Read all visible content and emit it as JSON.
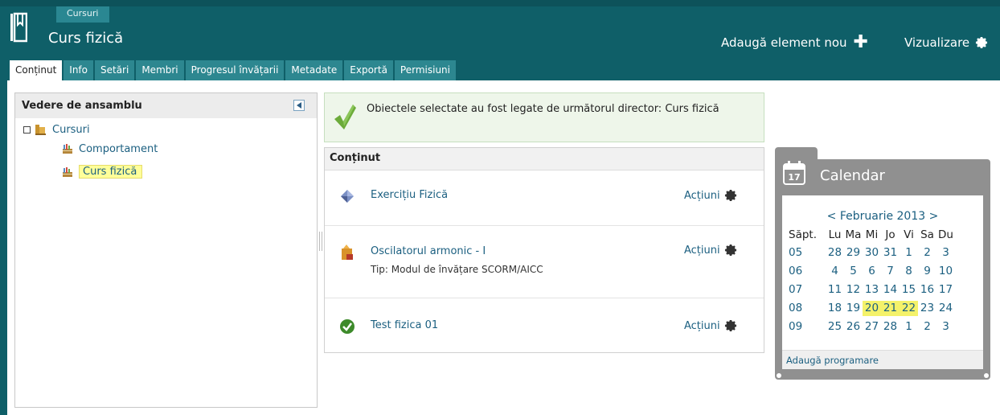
{
  "header": {
    "breadcrumb": "Cursuri",
    "title": "Curs fizică",
    "add_element_label": "Adaugă element nou",
    "view_label": "Vizualizare",
    "bg_color": "#0f5f68"
  },
  "tabs": [
    {
      "label": "Conținut",
      "active": true
    },
    {
      "label": "Info",
      "active": false
    },
    {
      "label": "Setări",
      "active": false
    },
    {
      "label": "Membri",
      "active": false
    },
    {
      "label": "Progresul învățarii",
      "active": false
    },
    {
      "label": "Metadate",
      "active": false
    },
    {
      "label": "Exportă",
      "active": false
    },
    {
      "label": "Permisiuni",
      "active": false
    }
  ],
  "tree": {
    "title": "Vedere de ansamblu",
    "items": [
      {
        "label": "Cursuri",
        "icon": "folder-icon"
      },
      {
        "label": "Comportament",
        "icon": "course-icon"
      },
      {
        "label": "Curs fizică",
        "icon": "course-icon",
        "selected": true
      }
    ]
  },
  "message": {
    "text": "Obiectele selectate au fost legate de următorul director: Curs fizică"
  },
  "content": {
    "title": "Conținut",
    "actions_label": "Acțiuni",
    "items": [
      {
        "title": "Exercițiu Fizică",
        "subtitle": "",
        "icon": "exercise-icon"
      },
      {
        "title": "Oscilatorul armonic - I",
        "subtitle": "Tip: Modul de învățare SCORM/AICC",
        "icon": "scorm-module-icon"
      },
      {
        "title": "Test fizica 01",
        "subtitle": "",
        "icon": "test-check-icon"
      }
    ]
  },
  "calendar": {
    "title": "Calendar",
    "icon_day": "17",
    "month_label": "< Februarie 2013 >",
    "week_header": "Săpt.",
    "weekdays": [
      "Lu",
      "Ma",
      "Mi",
      "Jo",
      "Vi",
      "Sa",
      "Du"
    ],
    "weeks": [
      {
        "week": "05",
        "days": [
          "28",
          "29",
          "30",
          "31",
          "1",
          "2",
          "3"
        ]
      },
      {
        "week": "06",
        "days": [
          "4",
          "5",
          "6",
          "7",
          "8",
          "9",
          "10"
        ]
      },
      {
        "week": "07",
        "days": [
          "11",
          "12",
          "13",
          "14",
          "15",
          "16",
          "17"
        ]
      },
      {
        "week": "08",
        "days": [
          "18",
          "19",
          "20",
          "21",
          "22",
          "23",
          "24"
        ]
      },
      {
        "week": "09",
        "days": [
          "25",
          "26",
          "27",
          "28",
          "1",
          "2",
          "3"
        ]
      }
    ],
    "highlighted_days": [
      "20",
      "21",
      "22"
    ],
    "highlight_color": "#f4f26a",
    "footer_link": "Adaugă programare"
  }
}
